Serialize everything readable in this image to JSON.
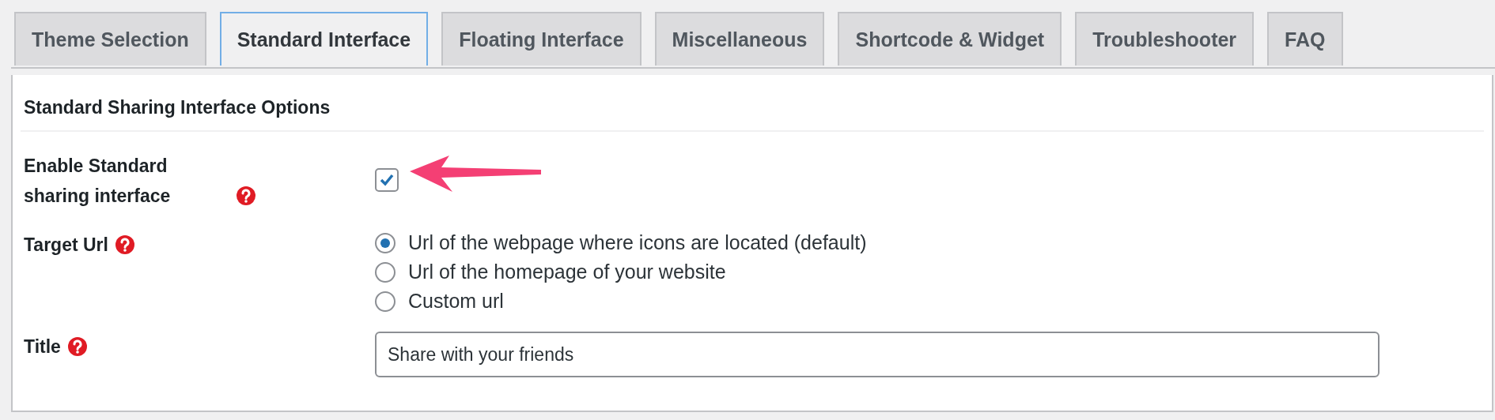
{
  "tabs": [
    {
      "label": "Theme Selection",
      "selected": false
    },
    {
      "label": "Standard Interface",
      "selected": true
    },
    {
      "label": "Floating Interface",
      "selected": false
    },
    {
      "label": "Miscellaneous",
      "selected": false
    },
    {
      "label": "Shortcode & Widget",
      "selected": false
    },
    {
      "label": "Troubleshooter",
      "selected": false
    },
    {
      "label": "FAQ",
      "selected": false
    }
  ],
  "panel": {
    "heading": "Standard Sharing Interface Options",
    "rows": [
      {
        "kind": "checkbox",
        "label": "Enable Standard sharing interface",
        "checked": true
      },
      {
        "kind": "radios",
        "label": "Target Url",
        "options": [
          {
            "label": "Url of the webpage where icons are located (default)",
            "selected": true
          },
          {
            "label": "Url of the homepage of your website",
            "selected": false
          },
          {
            "label": "Custom url",
            "selected": false
          }
        ]
      },
      {
        "kind": "text",
        "label": "Title",
        "value": "Share with your friends"
      }
    ]
  }
}
